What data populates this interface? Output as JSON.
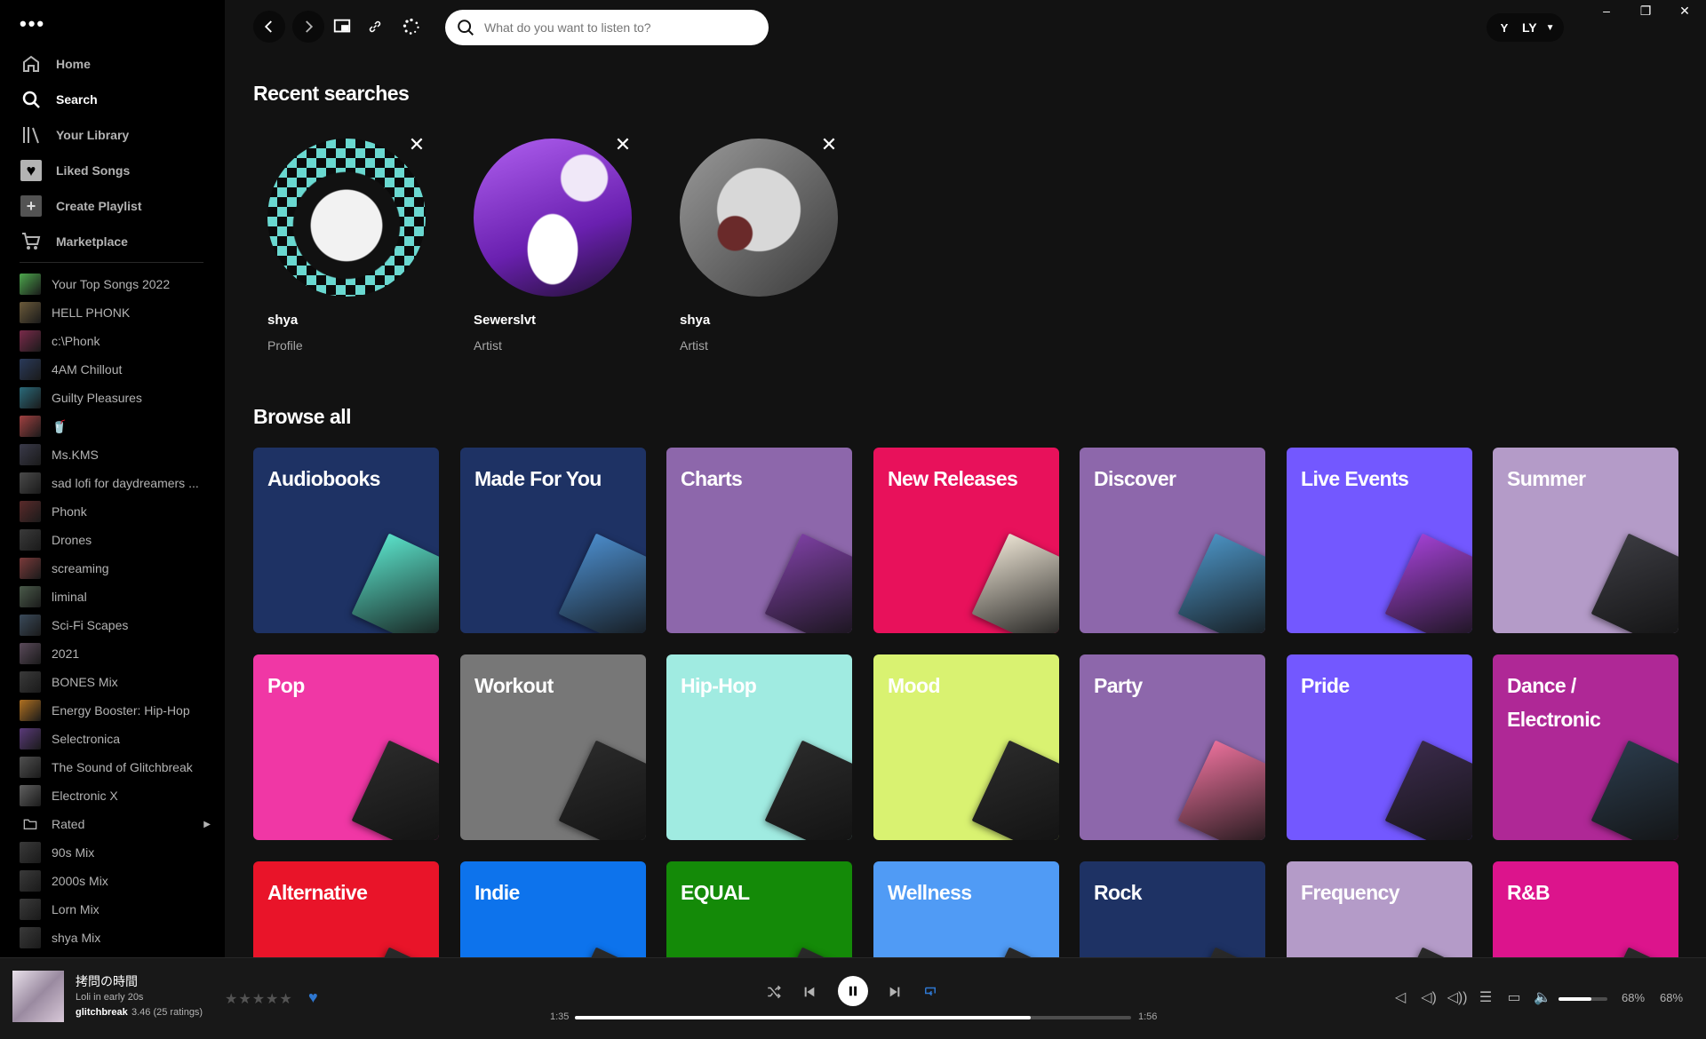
{
  "window": {
    "minimize": "–",
    "restore": "❐",
    "close": "✕"
  },
  "sidebar": {
    "menu_dots": "•••",
    "nav": [
      {
        "label": "Home",
        "icon": "home-icon"
      },
      {
        "label": "Search",
        "icon": "search-icon"
      },
      {
        "label": "Your Library",
        "icon": "library-icon"
      },
      {
        "label": "Liked Songs",
        "icon": "heart-icon"
      },
      {
        "label": "Create Playlist",
        "icon": "plus-icon"
      },
      {
        "label": "Marketplace",
        "icon": "cart-icon"
      }
    ],
    "playlists": [
      {
        "label": "Your Top Songs 2022",
        "color": "#4ca64c"
      },
      {
        "label": "HELL PHONK",
        "color": "#6b5a3a"
      },
      {
        "label": "c:\\Phonk",
        "color": "#7a2a4a"
      },
      {
        "label": "4AM Chillout",
        "color": "#2a3a5a"
      },
      {
        "label": "Guilty Pleasures",
        "color": "#2a6a7a"
      },
      {
        "label": "🥤",
        "color": "#a04040"
      },
      {
        "label": "Ms.KMS",
        "color": "#3a3a4a"
      },
      {
        "label": "sad lofi for daydreamers ...",
        "color": "#4a4a4a"
      },
      {
        "label": "Phonk",
        "color": "#5a2a2a"
      },
      {
        "label": "Drones",
        "color": "#3a3a3a"
      },
      {
        "label": "screaming",
        "color": "#7a3a3a"
      },
      {
        "label": "liminal",
        "color": "#4a5a4a"
      },
      {
        "label": "Sci-Fi Scapes",
        "color": "#3a4a5a"
      },
      {
        "label": "2021",
        "color": "#5a4a5a"
      },
      {
        "label": "BONES Mix",
        "color": "#3a3a3a"
      },
      {
        "label": "Energy Booster: Hip-Hop",
        "color": "#b07020"
      },
      {
        "label": "Selectronica",
        "color": "#5a3a7a"
      },
      {
        "label": "The Sound of Glitchbreak",
        "color": "#505050"
      },
      {
        "label": "Electronic X",
        "color": "#606060"
      },
      {
        "label": "Rated",
        "folder": true
      },
      {
        "label": "90s Mix",
        "color": "#3a3a3a"
      },
      {
        "label": "2000s Mix",
        "color": "#3a3a3a"
      },
      {
        "label": "Lorn Mix",
        "color": "#3a3a3a"
      },
      {
        "label": "shya Mix",
        "color": "#3a3a3a"
      }
    ]
  },
  "topbar": {
    "search_placeholder": "What do you want to listen to?",
    "user_label": "LY",
    "user_avatar": "Y"
  },
  "recent": {
    "title": "Recent searches",
    "items": [
      {
        "name": "shya",
        "type": "Profile"
      },
      {
        "name": "Sewerslvt",
        "type": "Artist"
      },
      {
        "name": "shya",
        "type": "Artist"
      }
    ]
  },
  "browse": {
    "title": "Browse all",
    "tiles": [
      {
        "label": "Audiobooks",
        "color": "#1e3264",
        "cover": "#5ae0c8"
      },
      {
        "label": "Made For You",
        "color": "#1e3264",
        "cover": "#4a8ac8"
      },
      {
        "label": "Charts",
        "color": "#8d67ab",
        "cover": "#7b3fa0"
      },
      {
        "label": "New Releases",
        "color": "#e8115b",
        "cover": "#e8e0d0"
      },
      {
        "label": "Discover",
        "color": "#8d67ab",
        "cover": "#4a90c0"
      },
      {
        "label": "Live Events",
        "color": "#7358ff",
        "cover": "#a040d0"
      },
      {
        "label": "Summer",
        "color": "#b49bc8",
        "cover": "#3a3a40"
      },
      {
        "label": "Pop",
        "color": "#f037a5",
        "cover": "#2a2a2a"
      },
      {
        "label": "Workout",
        "color": "#777777",
        "cover": "#2a2a2a"
      },
      {
        "label": "Hip-Hop",
        "color": "#a0ebe1",
        "cover": "#2a2a2a"
      },
      {
        "label": "Mood",
        "color": "#d9f271",
        "cover": "#2a2a2a"
      },
      {
        "label": "Party",
        "color": "#8d67ab",
        "cover": "#e8709a"
      },
      {
        "label": "Pride",
        "color": "#7358ff",
        "cover": "#3a2a4a"
      },
      {
        "label": "Dance / Electronic",
        "color": "#af2896",
        "cover": "#2a3a4a"
      },
      {
        "label": "Alternative",
        "color": "#e91429",
        "cover": "#2a2a2a"
      },
      {
        "label": "Indie",
        "color": "#0d73ec",
        "cover": "#2a2a2a"
      },
      {
        "label": "EQUAL",
        "color": "#148a08",
        "cover": "#2a2a2a"
      },
      {
        "label": "Wellness",
        "color": "#509bf5",
        "cover": "#2a2a2a"
      },
      {
        "label": "Rock",
        "color": "#1e3264",
        "cover": "#2a2a2a"
      },
      {
        "label": "Frequency",
        "color": "#b49bc8",
        "cover": "#2a2a2a"
      },
      {
        "label": "R&B",
        "color": "#dc148c",
        "cover": "#2a2a2a"
      }
    ]
  },
  "player": {
    "title": "拷問の時間",
    "subtitle": "Loli in early 20s",
    "artist": "glitchbreak",
    "rating": "3.46 (25 ratings)",
    "stars": "★★★★★",
    "elapsed": "1:35",
    "duration": "1:56",
    "progress": 0.82,
    "volume": 0.68,
    "volume_pct": "68%",
    "volume_pct2": "68%"
  }
}
